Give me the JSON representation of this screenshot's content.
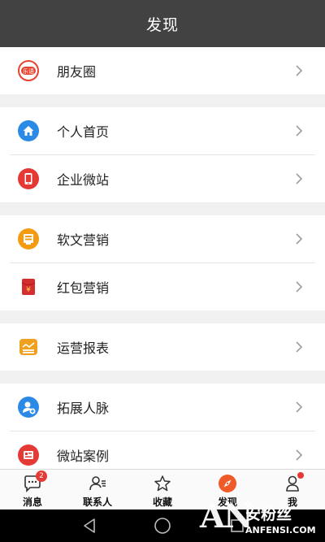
{
  "header": {
    "title": "发现"
  },
  "menu": {
    "moments": {
      "label": "朋友圈",
      "icon": "lequ-chat-icon",
      "badge_text": "乐语",
      "color": "#e8432e"
    },
    "homepage": {
      "label": "个人首页",
      "icon": "home-icon",
      "color": "#2b8ae6"
    },
    "microsite": {
      "label": "企业微站",
      "icon": "tablet-icon",
      "color": "#e53935"
    },
    "softtext": {
      "label": "软文营销",
      "icon": "document-icon",
      "color": "#f39c12"
    },
    "redpacket": {
      "label": "红包营销",
      "icon": "red-envelope-icon",
      "color": "#d32f2f",
      "symbol": "¥"
    },
    "reports": {
      "label": "运营报表",
      "icon": "report-icon",
      "color": "#f0a020"
    },
    "network": {
      "label": "拓展人脉",
      "icon": "add-contact-icon",
      "color": "#2b8ae6"
    },
    "cases": {
      "label": "微站案例",
      "icon": "case-icon",
      "color": "#e53935"
    }
  },
  "tabs": {
    "messages": {
      "label": "消息",
      "badge": "2",
      "icon": "chat-bubble-icon"
    },
    "contacts": {
      "label": "联系人",
      "icon": "contacts-icon"
    },
    "favorites": {
      "label": "收藏",
      "icon": "star-icon"
    },
    "discover": {
      "label": "发现",
      "icon": "compass-icon",
      "active_color": "#f05a28"
    },
    "me": {
      "label": "我",
      "icon": "person-icon"
    }
  },
  "watermark": {
    "big": "AN",
    "cn": "安粉丝",
    "en": "ANFENSI.COM"
  }
}
